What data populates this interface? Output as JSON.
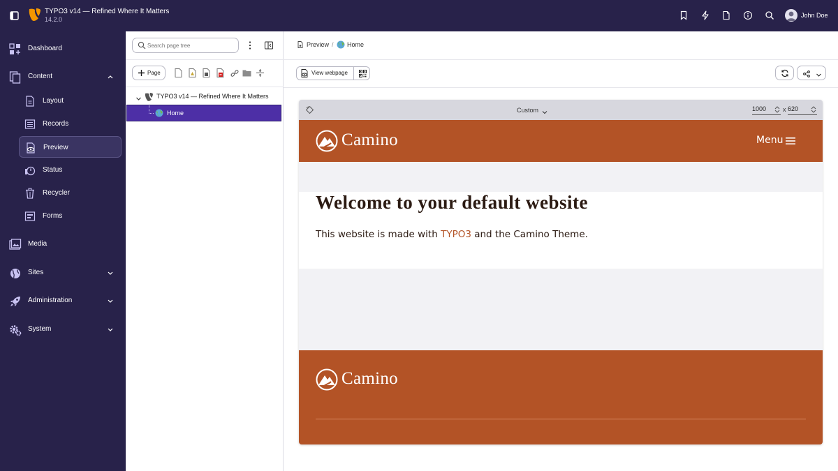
{
  "topbar": {
    "title": "TYPO3 v14 — Refined Where It Matters",
    "version": "14.2.0",
    "icons": [
      "bookmark-icon",
      "lightning-icon",
      "document-icon",
      "info-icon",
      "search-icon"
    ],
    "user_name": "John Doe"
  },
  "sidebar": {
    "items": [
      {
        "label": "Dashboard",
        "icon": "dashboard-icon"
      },
      {
        "label": "Content",
        "icon": "content-icon",
        "expanded": true,
        "children": [
          {
            "label": "Layout",
            "icon": "layout-icon"
          },
          {
            "label": "Records",
            "icon": "records-icon"
          },
          {
            "label": "Preview",
            "icon": "preview-icon",
            "active": true
          },
          {
            "label": "Status",
            "icon": "status-icon"
          },
          {
            "label": "Recycler",
            "icon": "trash-icon"
          },
          {
            "label": "Forms",
            "icon": "forms-icon"
          }
        ]
      },
      {
        "label": "Media",
        "icon": "media-icon"
      },
      {
        "label": "Sites",
        "icon": "globe-icon",
        "expanded": false
      },
      {
        "label": "Administration",
        "icon": "rocket-icon",
        "expanded": false
      },
      {
        "label": "System",
        "icon": "gears-icon",
        "expanded": false
      }
    ]
  },
  "tree": {
    "search_placeholder": "Search page tree",
    "new_page_label": "Page",
    "root_label": "TYPO3 v14 — Refined Where It Matters",
    "home_label": "Home"
  },
  "main": {
    "breadcrumb": [
      "Preview",
      "Home"
    ],
    "view_webpage_label": "View webpage",
    "preview": {
      "preset": "Custom",
      "width": "1000",
      "separator": "x",
      "height": "620"
    }
  },
  "site": {
    "brand": "Camino",
    "menu_label": "Menu",
    "heading": "Welcome to your default website",
    "text_before": "This website is made with ",
    "link_text": "TYPO3",
    "text_after": " and the Camino Theme.",
    "footer_brand": "Camino"
  },
  "colors": {
    "backend_dark": "#28224a",
    "active_tree": "#4d2fa6",
    "camino_brand": "#b35326"
  }
}
